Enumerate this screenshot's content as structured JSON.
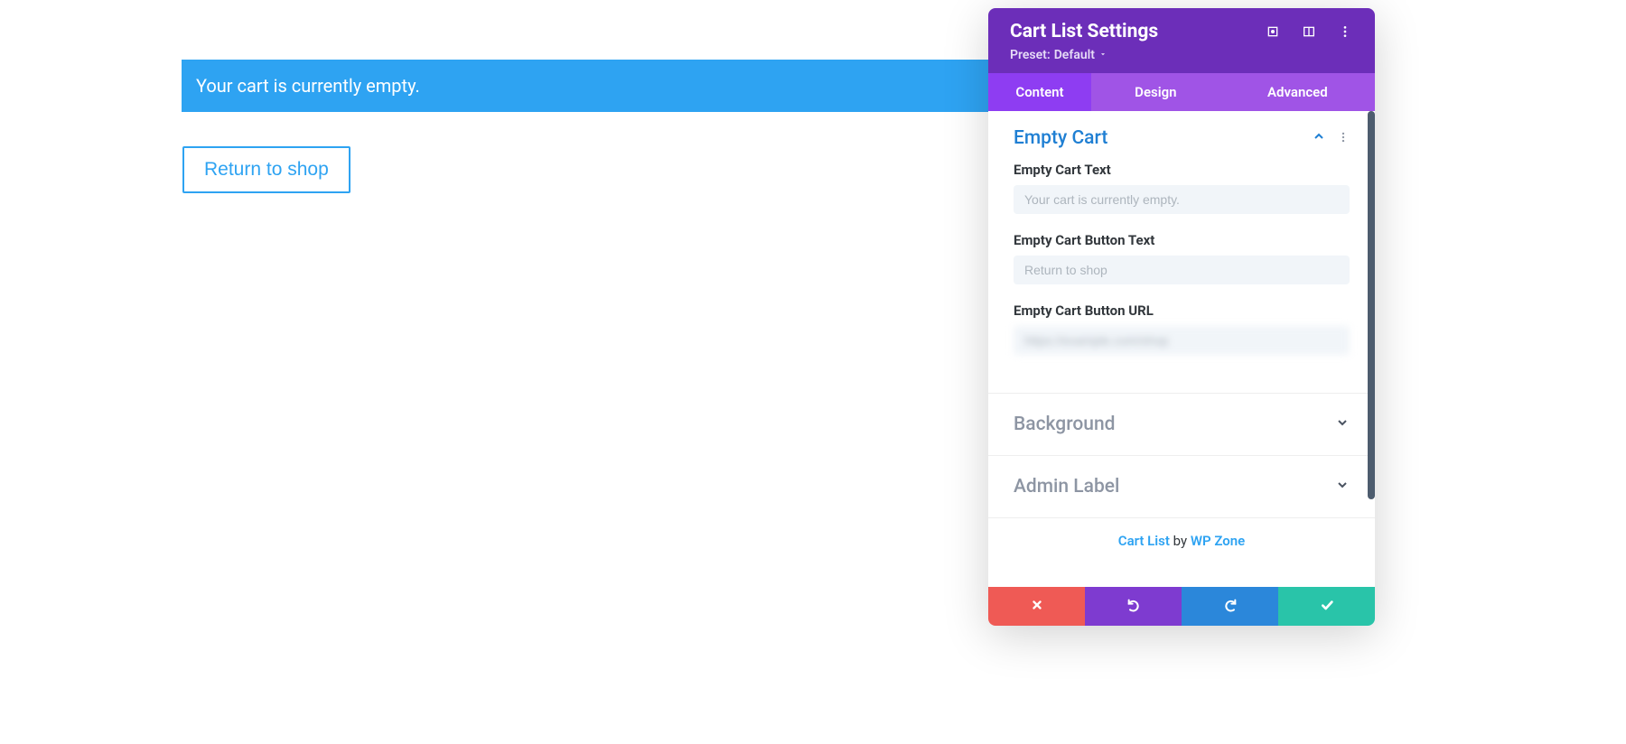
{
  "preview": {
    "notice_text": "Your cart is currently empty.",
    "return_button_text": "Return to shop"
  },
  "panel": {
    "title": "Cart List Settings",
    "preset_label": "Preset:",
    "preset_value": "Default",
    "tabs": {
      "content": "Content",
      "design": "Design",
      "advanced": "Advanced"
    },
    "sections": {
      "empty_cart": {
        "title": "Empty Cart",
        "fields": {
          "text": {
            "label": "Empty Cart Text",
            "placeholder": "Your cart is currently empty."
          },
          "button_text": {
            "label": "Empty Cart Button Text",
            "placeholder": "Return to shop"
          },
          "button_url": {
            "label": "Empty Cart Button URL",
            "placeholder": "https://example.com/shop"
          }
        }
      },
      "background": {
        "title": "Background"
      },
      "admin_label": {
        "title": "Admin Label"
      }
    },
    "credit": {
      "product": "Cart List",
      "by": " by ",
      "author": "WP Zone"
    }
  }
}
